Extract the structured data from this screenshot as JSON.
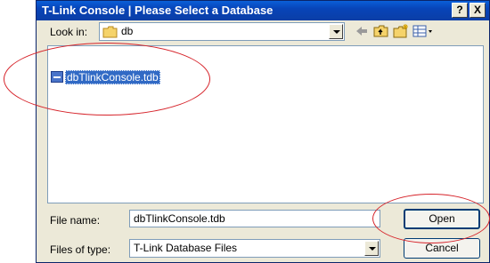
{
  "window": {
    "title": "T-Link Console | Please Select a Database",
    "help_glyph": "?",
    "close_glyph": "X"
  },
  "toolbar": {
    "look_in_label": "Look in:",
    "look_in_value": "db",
    "back_icon": "back-arrow-icon",
    "up_icon": "up-folder-icon",
    "new_folder_icon": "new-folder-icon",
    "view_menu_icon": "view-menu-icon"
  },
  "files": [
    {
      "name": "dbTlinkConsole.tdb",
      "selected": true,
      "icon": "database-file-icon"
    }
  ],
  "form": {
    "file_name_label": "File name:",
    "file_name_value": "dbTlinkConsole.tdb",
    "files_of_type_label": "Files of type:",
    "files_of_type_value": "T-Link Database Files"
  },
  "buttons": {
    "open_label": "Open",
    "cancel_label": "Cancel"
  },
  "colors": {
    "title_bar": "#0a44b8",
    "dialog_bg": "#ece9d8",
    "selection": "#316ac5",
    "annotation_ellipse": "#d6232a"
  }
}
